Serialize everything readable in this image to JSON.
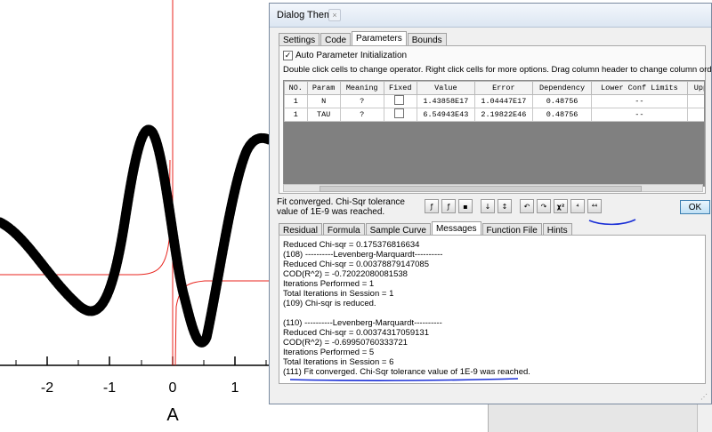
{
  "plot": {
    "x_ticks": [
      "-2",
      "-1",
      "0",
      "1"
    ],
    "x_axis_label": "A",
    "curve_color": "#000000",
    "fit_color": "#e8231c"
  },
  "dialog": {
    "title": "Dialog Theme",
    "close_glyph": "×",
    "top_tabs": [
      {
        "label": "Settings",
        "active": false
      },
      {
        "label": "Code",
        "active": false
      },
      {
        "label": "Parameters",
        "active": true
      },
      {
        "label": "Bounds",
        "active": false
      }
    ],
    "auto_param_label": "Auto Parameter Initialization",
    "auto_param_checked": true,
    "help_text": "Double click cells to change operator. Right click cells for more options. Drag column header to change column orders.",
    "columns": [
      "NO.",
      "Param",
      "Meaning",
      "Fixed",
      "Value",
      "Error",
      "Dependency",
      "Lower Conf Limits",
      "Upper Conf"
    ],
    "rows": [
      {
        "no": "1",
        "param": "N",
        "meaning": "?",
        "fixed": false,
        "value": "1.43858E17",
        "error": "1.04447E17",
        "dependency": "0.48756",
        "lower": "--",
        "upper": "--"
      },
      {
        "no": "1",
        "param": "TAU",
        "meaning": "?",
        "fixed": false,
        "value": "6.54943E43",
        "error": "2.19822E46",
        "dependency": "0.48756",
        "lower": "--",
        "upper": "--"
      }
    ],
    "status_message": "Fit converged. Chi-Sqr tolerance value of 1E-9 was reached.",
    "toolbar_icons": [
      "parameter-icon",
      "fit-icon",
      "save-icon",
      "sort-down-icon",
      "sort-up-icon",
      "undo-icon",
      "redo-icon",
      "chi-square-icon",
      "one-iteration-icon",
      "fit-till-converge-icon"
    ],
    "toolbar_glyphs": [
      "ƒ",
      "ƒ",
      "▪",
      "↓",
      "↕",
      "↶",
      "↷",
      "χ²",
      "⁴",
      "⁴⁴"
    ],
    "ok_label": "OK",
    "bottom_tabs": [
      {
        "label": "Residual",
        "active": false
      },
      {
        "label": "Formula",
        "active": false
      },
      {
        "label": "Sample Curve",
        "active": false
      },
      {
        "label": "Messages",
        "active": true
      },
      {
        "label": "Function File",
        "active": false
      },
      {
        "label": "Hints",
        "active": false
      }
    ],
    "messages": [
      "Reduced Chi-sqr = 0.175376816634",
      "(108) ----------Levenberg-Marquardt----------",
      "Reduced Chi-sqr = 0.00378879147085",
      "COD(R^2) = -0.72022080081538",
      "Iterations Performed = 1",
      "Total Iterations in Session = 1",
      "(109) Chi-sqr is reduced.",
      "",
      "(110) ----------Levenberg-Marquardt----------",
      "Reduced Chi-sqr = 0.00374317059131",
      "COD(R^2) = -0.69950760333721",
      "Iterations Performed = 5",
      "Total Iterations in Session = 6",
      "(111) Fit converged. Chi-Sqr tolerance value of 1E-9 was reached."
    ],
    "annotation_color": "#1a2fd6"
  }
}
